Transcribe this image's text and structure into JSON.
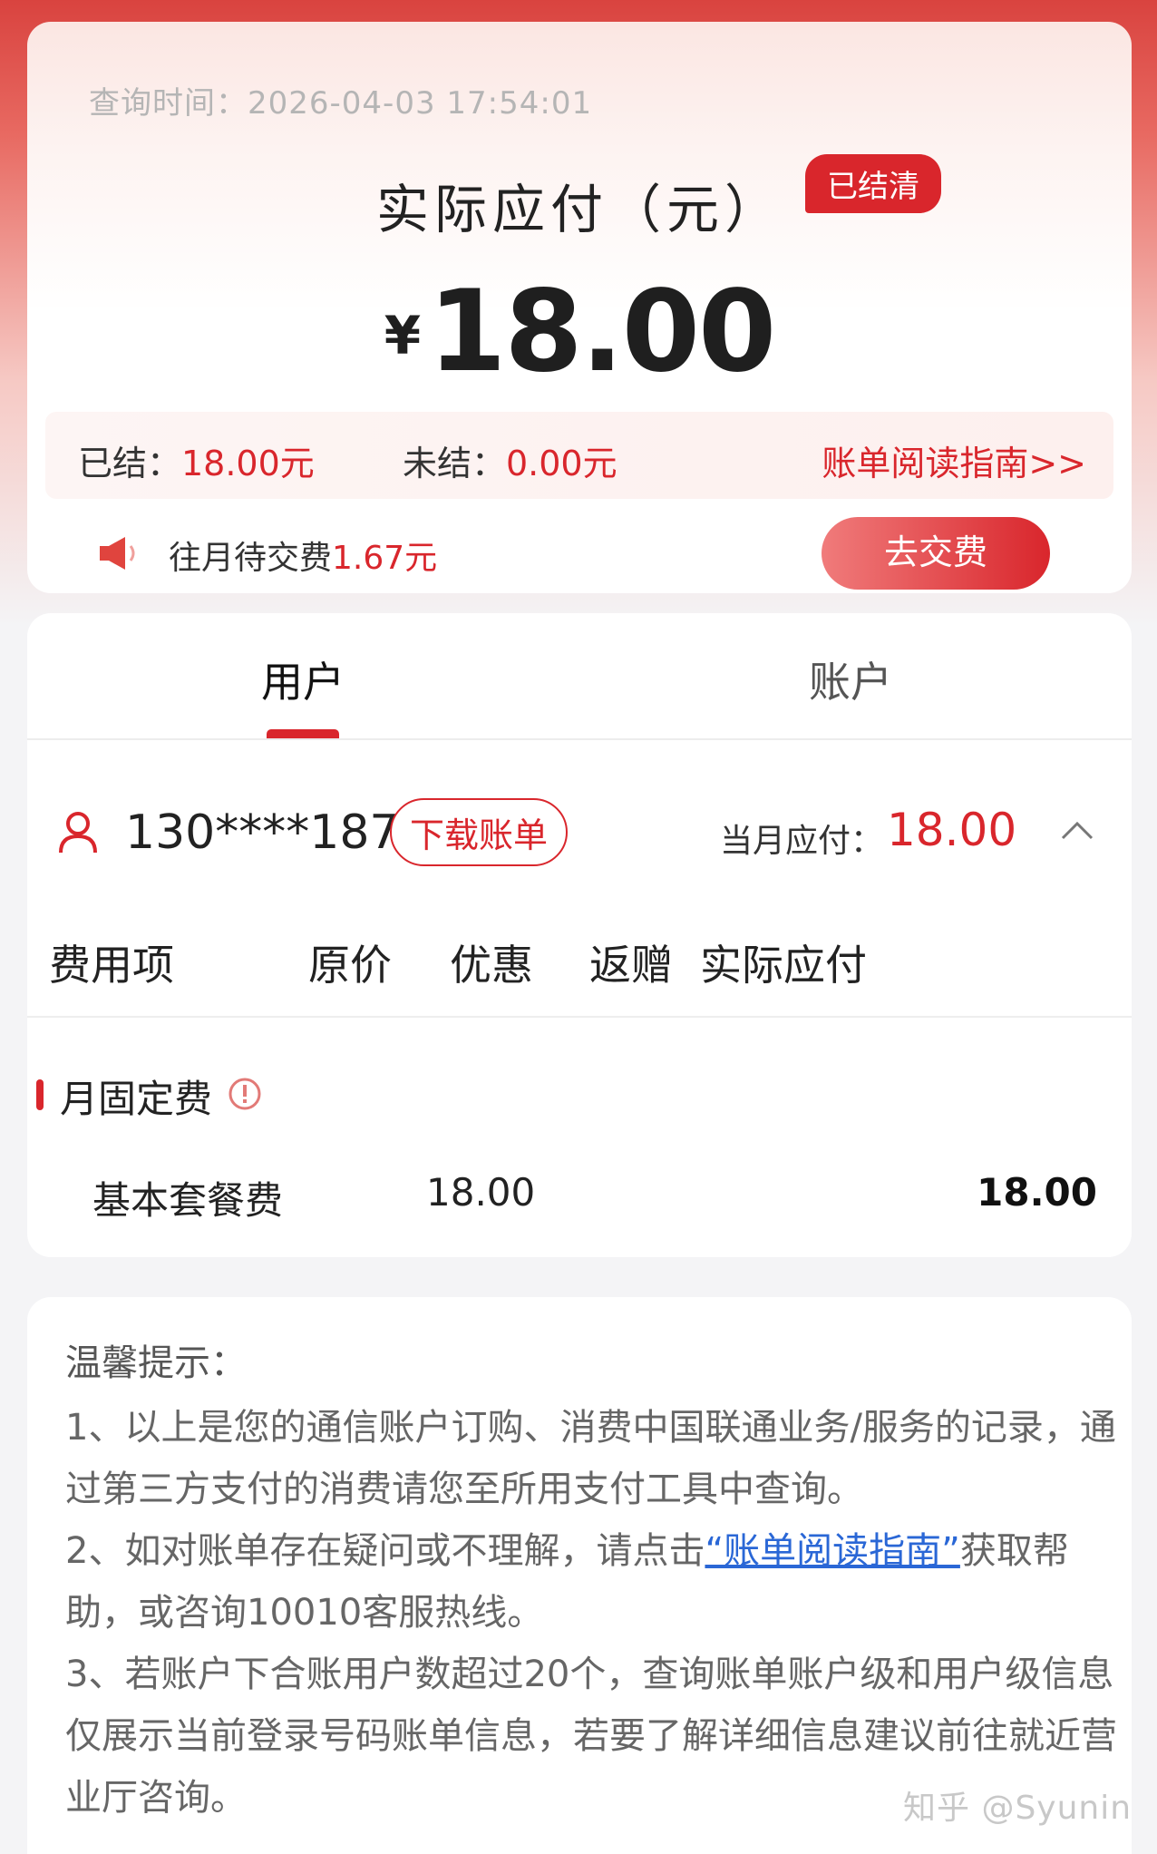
{
  "summary": {
    "query_time": "查询时间：2026-04-03 17:54:01",
    "title": "实际应付（元）",
    "status_badge": "已结清",
    "currency": "¥",
    "amount": "18.00",
    "settled_label": "已结：",
    "settled_value": "18.00元",
    "unsettled_label": "未结：",
    "unsettled_value": "0.00元",
    "guide_link": "账单阅读指南>>",
    "pending_label": "往月待交费",
    "pending_value": "1.67元",
    "pay_button": "去交费"
  },
  "tabs": [
    {
      "label": "用户",
      "active": true
    },
    {
      "label": "账户",
      "active": false
    }
  ],
  "user_bill": {
    "phone": "130****1872",
    "download_button": "下载账单",
    "month_due_label": "当月应付：",
    "month_due_value": "18.00",
    "columns": [
      "费用项",
      "原价",
      "优惠",
      "返赠",
      "实际应付"
    ],
    "section_title": "月固定费",
    "rows": [
      {
        "name": "基本套餐费",
        "original": "18.00",
        "discount": "",
        "gift": "",
        "actual": "18.00"
      }
    ]
  },
  "tips": {
    "title": "温馨提示：",
    "tip1": "1、以上是您的通信账户订购、消费中国联通业务/服务的记录，通过第三方支付的消费请您至所用支付工具中查询。",
    "tip2_before": "2、如对账单存在疑问或不理解，请点击",
    "tip2_link": "“账单阅读指南”",
    "tip2_after": "获取帮助，或咨询10010客服热线。",
    "tip3": "3、若账户下合账用户数超过20个，查询账单账户级和用户级信息仅展示当前登录号码账单信息，若要了解详细信息建议前往就近营业厅咨询。"
  },
  "watermark": "知乎 @Syunin",
  "colors": {
    "accent": "#d9262c",
    "link": "#2a67d6"
  }
}
